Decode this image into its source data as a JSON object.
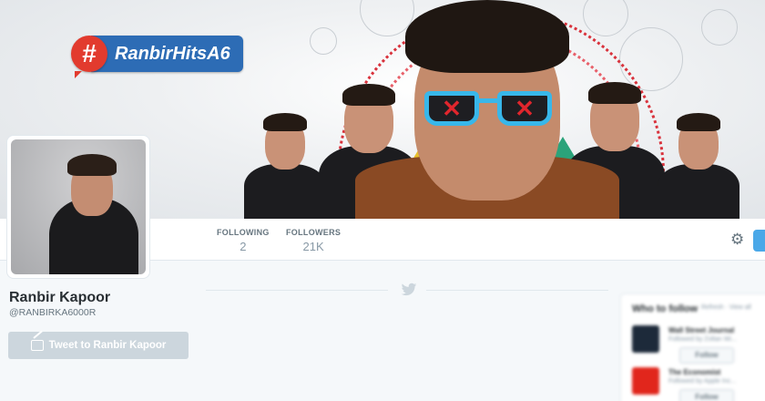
{
  "header": {
    "hashtag_symbol": "#",
    "hashtag_text": "RanbirHitsA6",
    "accent_red": "#e23b2e",
    "accent_blue": "#2d6cb5",
    "lens_mark": "✕"
  },
  "profile": {
    "name": "Ranbir Kapoor",
    "handle": "@RANBIRKA6000R",
    "tweet_button_label": "Tweet to Ranbir Kapoor"
  },
  "stats": {
    "following_label": "FOLLOWING",
    "following_value": "2",
    "followers_label": "FOLLOWERS",
    "followers_value": "21K"
  },
  "nav": {
    "settings_icon": "⚙"
  },
  "who_to_follow": {
    "title": "Who to follow",
    "refresh": "Refresh · View all",
    "items": [
      {
        "name": "Wall Street Journal",
        "sub": "Followed by Zoltan Wi...",
        "button": "Follow"
      },
      {
        "name": "The Economist",
        "sub": "Followed by Apple Inc...",
        "button": "Follow"
      }
    ]
  }
}
